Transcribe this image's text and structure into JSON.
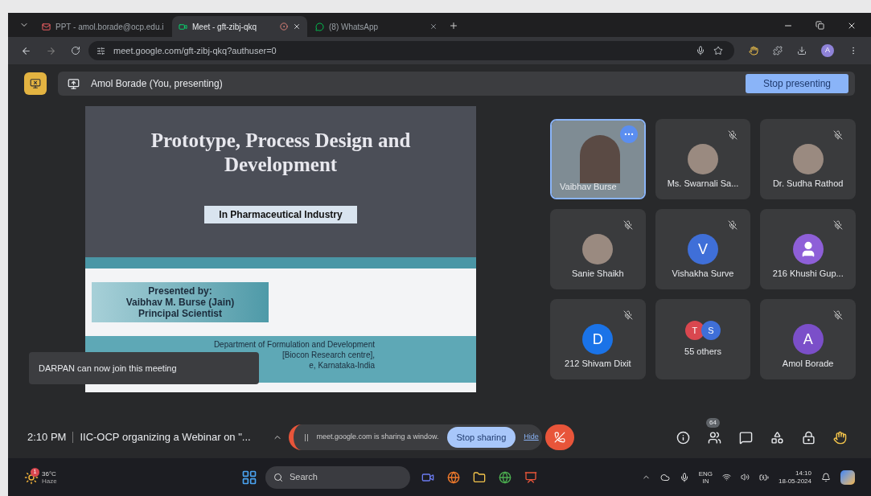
{
  "browser": {
    "tabs": [
      {
        "label": "PPT - amol.borade@ocp.edu.i",
        "selected": false,
        "kind": "mail"
      },
      {
        "label": "Meet - gft-zibj-qkq",
        "selected": true,
        "kind": "meet"
      },
      {
        "label": "(8) WhatsApp",
        "selected": false,
        "kind": "chat"
      }
    ],
    "address": "meet.google.com/gft-zibj-qkq?authuser=0",
    "profile_initial": "A"
  },
  "presenting_bar": {
    "label": "Amol Borade (You, presenting)",
    "button": "Stop presenting"
  },
  "slide": {
    "title": "Prototype, Process Design and Development",
    "subtitle": "In Pharmaceutical Industry",
    "presenter_lines": [
      "Presented by:",
      "Vaibhav M. Burse (Jain)",
      "Principal Scientist"
    ],
    "department_lines": [
      "Department of Formulation and Development",
      "[Biocon Research centre],",
      "e, Karnataka-India"
    ]
  },
  "toast": "DARPAN can now join this meeting",
  "participants": [
    {
      "name": "Vaibhav Burse",
      "kind": "video",
      "muted": false,
      "selected": true
    },
    {
      "name": "Ms. Swarnali Sa...",
      "kind": "photo",
      "muted": true,
      "selected": false
    },
    {
      "name": "Dr. Sudha Rathod",
      "kind": "photo",
      "muted": true,
      "selected": false
    },
    {
      "name": "Sanie Shaikh",
      "kind": "photo",
      "muted": true,
      "selected": false
    },
    {
      "name": "Vishakha Surve",
      "kind": "initial",
      "initial": "V",
      "color": "#3f6fd8",
      "muted": true,
      "selected": false
    },
    {
      "name": "216 Khushi Gup...",
      "kind": "generic",
      "color": "#8e5fd8",
      "muted": true,
      "selected": false
    },
    {
      "name": "212 Shivam Dixit",
      "kind": "initial",
      "initial": "D",
      "color": "#1a73e8",
      "muted": true,
      "selected": false
    },
    {
      "name": "55 others",
      "kind": "others",
      "initials": [
        {
          "initial": "T",
          "color": "#d9474f"
        },
        {
          "initial": "S",
          "color": "#3f6fd8"
        }
      ],
      "muted": false,
      "selected": false
    },
    {
      "name": "Amol Borade",
      "kind": "initial",
      "initial": "A",
      "color": "#7b4fc9",
      "muted": true,
      "selected": false
    }
  ],
  "meeting_bar": {
    "time": "2:10 PM",
    "title": "IIC-OCP organizing a Webinar on \"...",
    "share_notice": "meet.google.com is sharing a window.",
    "stop_sharing": "Stop sharing",
    "hide": "Hide",
    "people_count": "64"
  },
  "taskbar": {
    "weather_badge": "1",
    "temperature": "36°C",
    "weather": "Haze",
    "search": "Search",
    "language": "ENG",
    "region": "IN",
    "clock": "14:10",
    "date": "18-05-2024"
  }
}
